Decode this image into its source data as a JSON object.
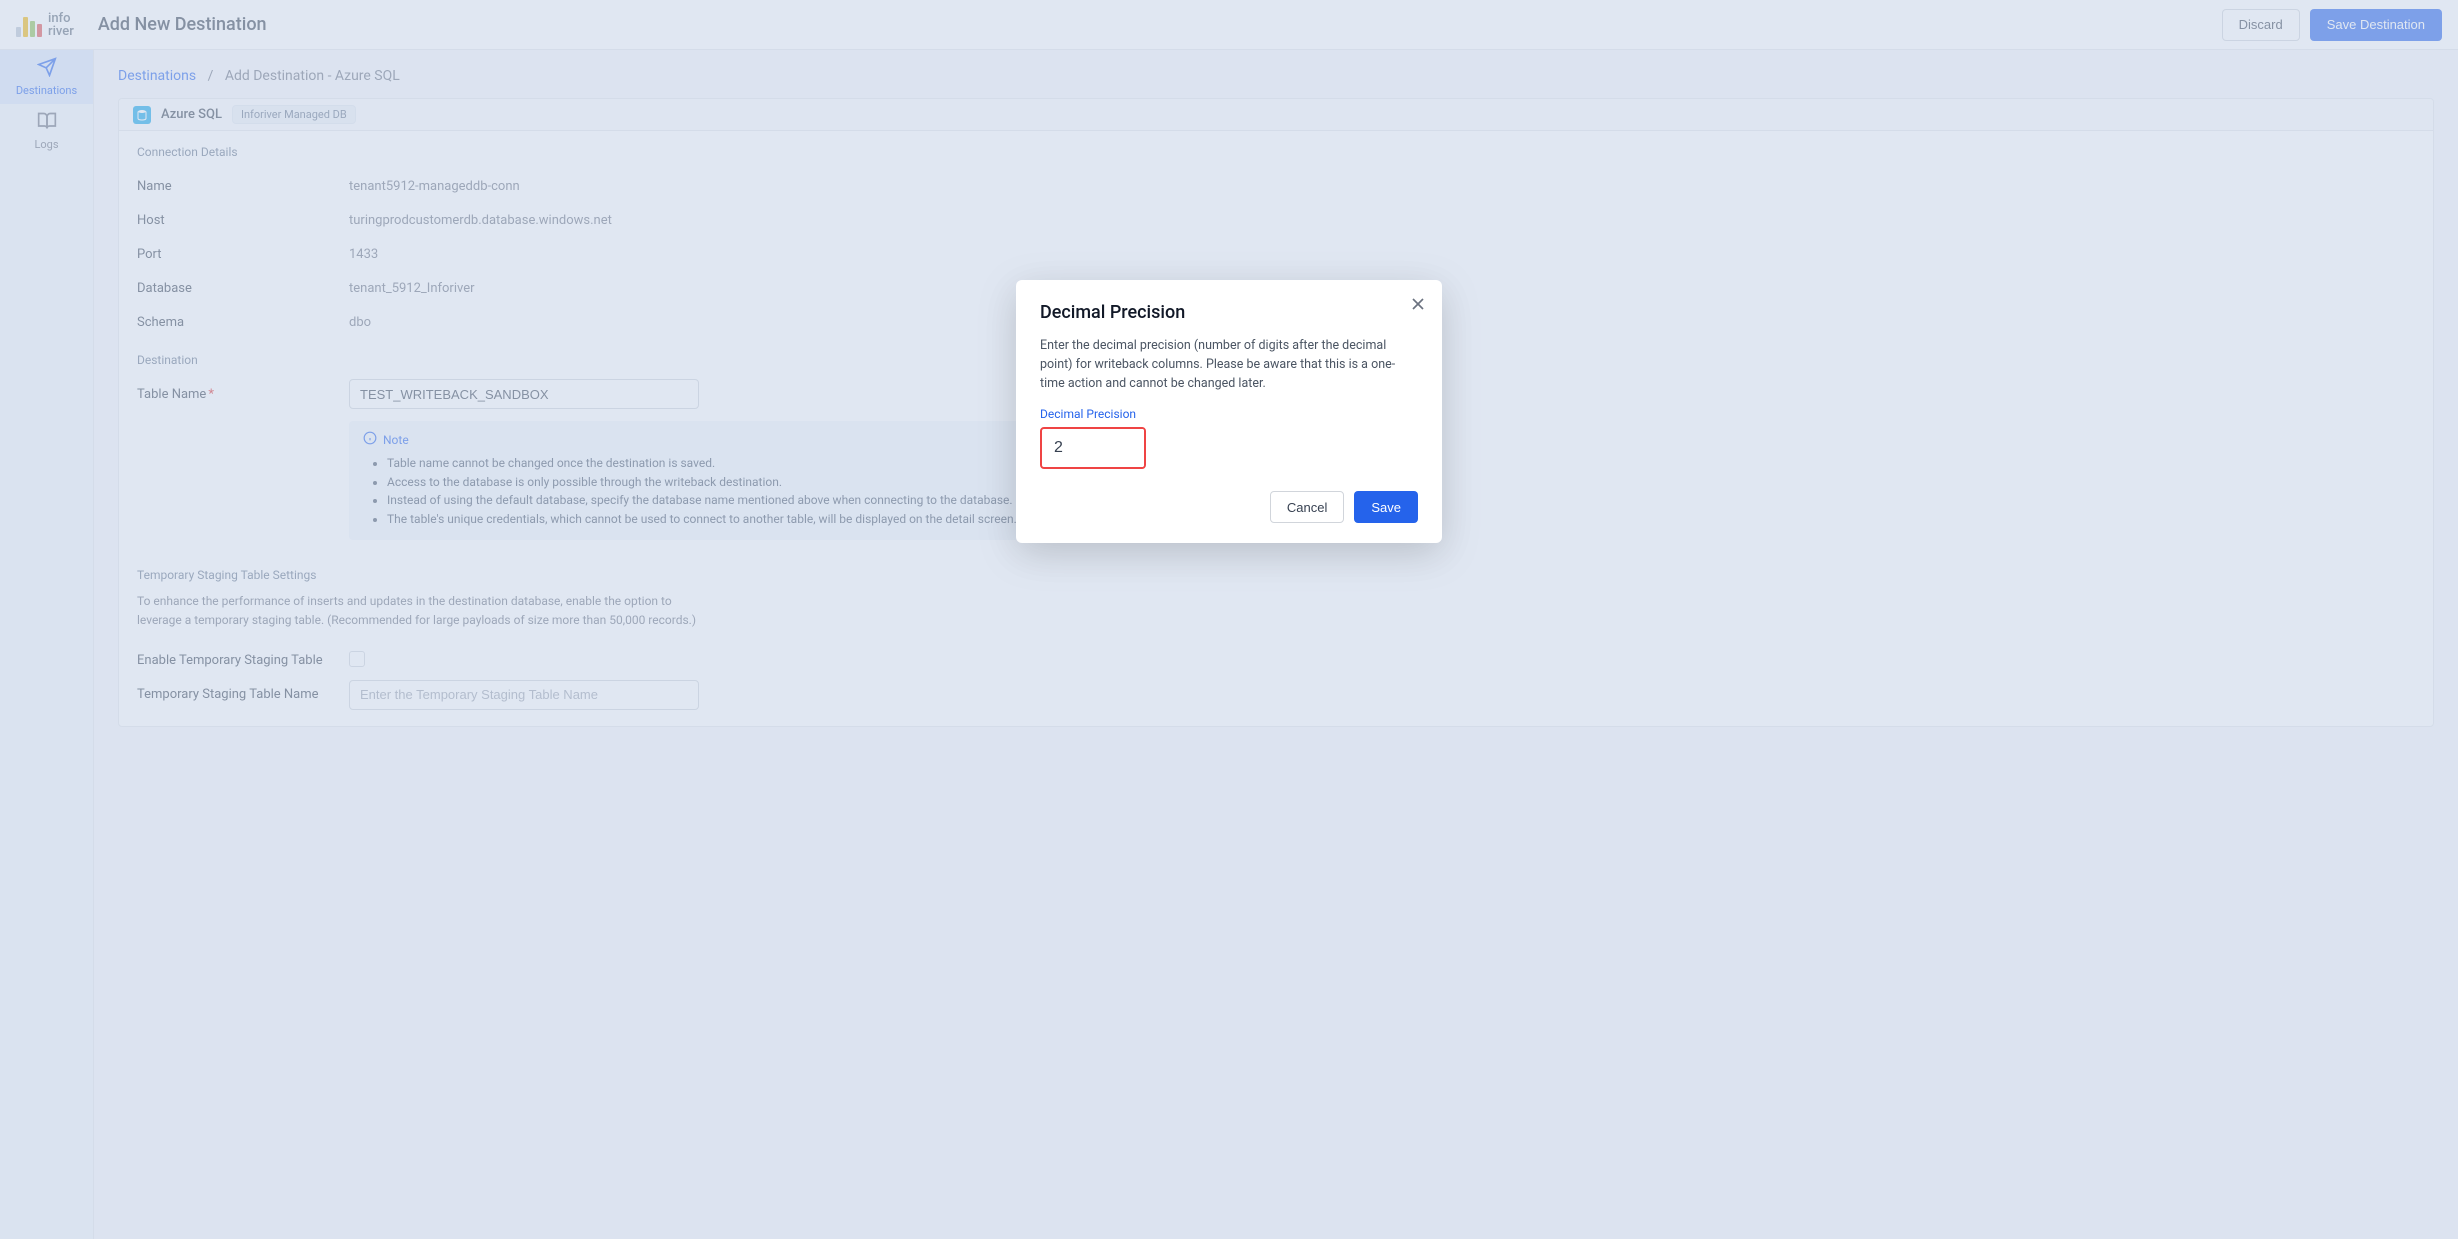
{
  "brand": {
    "name": "inforiver"
  },
  "header": {
    "title": "Add New Destination",
    "discard": "Discard",
    "save": "Save Destination"
  },
  "sidebar": {
    "items": [
      {
        "label": "Destinations",
        "icon": "send-icon",
        "active": true
      },
      {
        "label": "Logs",
        "icon": "book-icon",
        "active": false
      }
    ]
  },
  "breadcrumb": {
    "root": "Destinations",
    "current": "Add Destination - Azure SQL"
  },
  "panel": {
    "type": "Azure SQL",
    "badge": "Inforiver Managed DB"
  },
  "connection": {
    "title": "Connection Details",
    "name_label": "Name",
    "name_value": "tenant5912-manageddb-conn",
    "host_label": "Host",
    "host_value": "turingprodcustomerdb.database.windows.net",
    "port_label": "Port",
    "port_value": "1433",
    "database_label": "Database",
    "database_value": "tenant_5912_Inforiver",
    "schema_label": "Schema",
    "schema_value": "dbo"
  },
  "destination": {
    "title": "Destination",
    "table_label": "Table Name",
    "table_value": "TEST_WRITEBACK_SANDBOX"
  },
  "note": {
    "title": "Note",
    "items": [
      "Table name cannot be changed once the destination is saved.",
      "Access to the database is only possible through the writeback destination.",
      "Instead of using the default database, specify the database name mentioned above when connecting to the database.",
      "The table's unique credentials, which cannot be used to connect to another table, will be displayed on the detail screen."
    ]
  },
  "staging": {
    "title": "Temporary Staging Table Settings",
    "help": "To enhance the performance of inserts and updates in the destination database, enable the option to leverage a temporary staging table. (Recommended for large payloads of size more than 50,000 records.)",
    "enable_label": "Enable Temporary Staging Table",
    "name_label": "Temporary Staging Table Name",
    "name_placeholder": "Enter the Temporary Staging Table Name"
  },
  "dialog": {
    "title": "Decimal Precision",
    "body": "Enter the decimal precision (number of digits after the decimal point) for writeback columns. Please be aware that this is a one-time action and cannot be changed later.",
    "field_label": "Decimal Precision",
    "value": "2",
    "cancel": "Cancel",
    "save": "Save"
  }
}
